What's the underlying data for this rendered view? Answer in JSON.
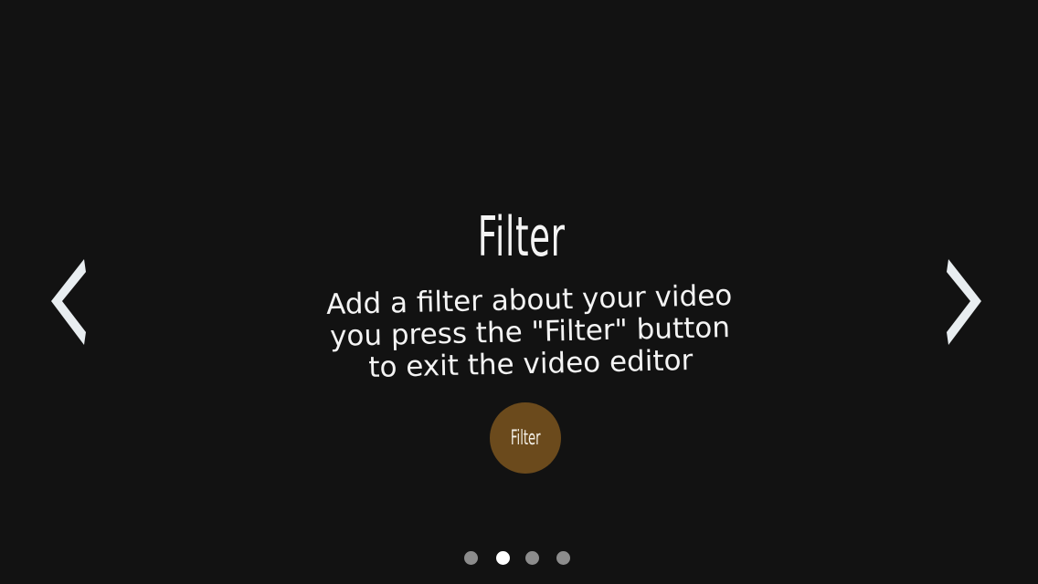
{
  "slide": {
    "title": "Filter",
    "description_lines": [
      "Add a filter about your video",
      "you press the \"Filter\" button",
      "to exit the video editor"
    ],
    "button_label": "Filter",
    "button_color": "#6b4a1c",
    "background_color": "#121212"
  },
  "navigation": {
    "prev_icon": "chevron-left-icon",
    "next_icon": "chevron-right-icon"
  },
  "pagination": {
    "total": 4,
    "active_index": 1,
    "active_color": "#ffffff",
    "inactive_color": "#8c8c8c"
  }
}
